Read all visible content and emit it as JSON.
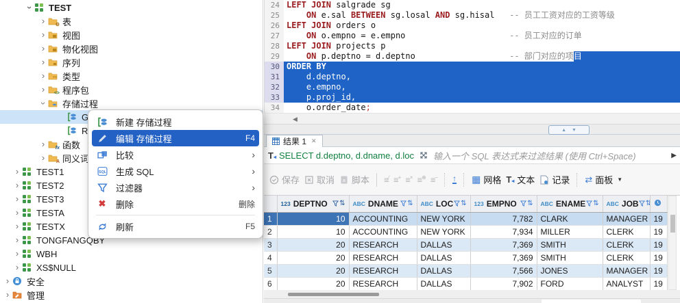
{
  "colors": {
    "accent": "#1e63c5",
    "menu_highlight": "#2461c4",
    "tree_selection": "#cce3f8",
    "keyword": "#9a1b1e",
    "comment": "#8a8a8a",
    "filter_sql_green": "#118040",
    "header_selected": "#7fb0dd",
    "active_cell": "#3d74b6",
    "selected_row": "#c7dcf1"
  },
  "icons": {
    "chevron": "›",
    "close": "✕",
    "submenu_arrow": "›",
    "delete_x": "✖",
    "left_scroll_arrow": "◀",
    "up_triangle": "▲",
    "down_triangle": "▼",
    "grid_glyph": "▦",
    "updown": "⇅",
    "up_arrow": "↑",
    "swap": "⇄",
    "play": "▶",
    "dropdown": "▼",
    "text_T": "T",
    "filter_T": "T",
    "tick": "◂",
    "sql_label": "SQL",
    "script_a": "a",
    "rop_lines": "≡",
    "rop1": "∕",
    "rop2": "+",
    "rop3": "×",
    "rop4": "⊕",
    "rop5": "−",
    "fx": "fx",
    "syn_A": "A",
    "pkg": "<>",
    "gear": "⚙"
  },
  "tree": {
    "items": [
      {
        "label": "TEST"
      },
      {
        "label": "表"
      },
      {
        "label": "视图"
      },
      {
        "label": "物化视图"
      },
      {
        "label": "序列"
      },
      {
        "label": "类型"
      },
      {
        "label": "程序包"
      },
      {
        "label": "存储过程"
      },
      {
        "label": "GET"
      },
      {
        "label": "RAI"
      },
      {
        "label": "函数"
      },
      {
        "label": "同义词"
      },
      {
        "label": "TEST1"
      },
      {
        "label": "TEST2"
      },
      {
        "label": "TEST3"
      },
      {
        "label": "TESTA"
      },
      {
        "label": "TESTX"
      },
      {
        "label": "TONGFANGQBY"
      },
      {
        "label": "WBH"
      },
      {
        "label": "XS$NULL"
      },
      {
        "label": "安全"
      },
      {
        "label": "管理"
      }
    ]
  },
  "menu": {
    "items": [
      {
        "label": "新建 存储过程",
        "accel": ""
      },
      {
        "label": "编辑 存储过程",
        "accel": "F4"
      },
      {
        "label": "比较",
        "accel": ""
      },
      {
        "label": "生成 SQL",
        "accel": ""
      },
      {
        "label": "过滤器",
        "accel": ""
      },
      {
        "label": "删除",
        "accel": "删除"
      },
      {
        "label": "刷新",
        "accel": "F5"
      }
    ]
  },
  "editor": {
    "lines": [
      {
        "no": "24",
        "segs": [
          {
            "c": "kw",
            "t": "LEFT JOIN"
          },
          {
            "c": "pl",
            "t": " salgrade sg"
          }
        ]
      },
      {
        "no": "25",
        "segs": [
          {
            "c": "pl",
            "t": "    "
          },
          {
            "c": "kw",
            "t": "ON"
          },
          {
            "c": "pl",
            "t": " e.sal "
          },
          {
            "c": "kw",
            "t": "BETWEEN"
          },
          {
            "c": "pl",
            "t": " sg.losal "
          },
          {
            "c": "kw",
            "t": "AND"
          },
          {
            "c": "pl",
            "t": " sg.hisal"
          },
          {
            "c": "cm",
            "t": "   -- 员工工资对应的工资等级"
          }
        ]
      },
      {
        "no": "26",
        "segs": [
          {
            "c": "kw",
            "t": "LEFT JOIN"
          },
          {
            "c": "pl",
            "t": " orders o"
          }
        ]
      },
      {
        "no": "27",
        "segs": [
          {
            "c": "pl",
            "t": "    "
          },
          {
            "c": "kw",
            "t": "ON"
          },
          {
            "c": "pl",
            "t": " o.empno = e.empno"
          },
          {
            "c": "cm",
            "t": "                     -- 员工对应的订单"
          }
        ]
      },
      {
        "no": "28",
        "segs": [
          {
            "c": "kw",
            "t": "LEFT JOIN"
          },
          {
            "c": "pl",
            "t": " projects p"
          }
        ]
      },
      {
        "no": "29",
        "segs": [
          {
            "c": "pl",
            "t": "    "
          },
          {
            "c": "kw",
            "t": "ON"
          },
          {
            "c": "pl",
            "t": " p.deptno = d.deptno"
          },
          {
            "c": "cm",
            "t": "                   -- 部门对应的项"
          }
        ],
        "tail": "目"
      },
      {
        "no": "30",
        "segs": [
          {
            "c": "kw",
            "t": "ORDER BY"
          }
        ]
      },
      {
        "no": "31",
        "segs": [
          {
            "c": "pl",
            "t": "    d.deptno,"
          }
        ]
      },
      {
        "no": "32",
        "segs": [
          {
            "c": "pl",
            "t": "    e.empno,"
          }
        ]
      },
      {
        "no": "33",
        "segs": [
          {
            "c": "pl",
            "t": "    p.proj_id,"
          }
        ]
      },
      {
        "no": "34",
        "segs": [
          {
            "c": "pl",
            "t": "    o.order_date"
          },
          {
            "c": "red",
            "t": ";"
          }
        ]
      }
    ]
  },
  "results": {
    "tab_label": "结果 1",
    "filter": {
      "sql": "SELECT d.deptno, d.dname, d.loc",
      "placeholder": "输入一个 SQL 表达式来过滤结果 (使用 Ctrl+Space)"
    },
    "toolbar": {
      "save": "保存",
      "cancel": "取消",
      "script": "脚本",
      "grid": "网格",
      "text": "文本",
      "record": "记录",
      "panels": "面板"
    },
    "grid": {
      "columns": [
        {
          "prefix": "123",
          "name": "DEPTNO"
        },
        {
          "prefix": "ABC",
          "name": "DNAME"
        },
        {
          "prefix": "ABC",
          "name": "LOC"
        },
        {
          "prefix": "123",
          "name": "EMPNO"
        },
        {
          "prefix": "ABC",
          "name": "ENAME"
        },
        {
          "prefix": "ABC",
          "name": "JOB"
        }
      ],
      "rows": [
        {
          "n": "1",
          "deptno": "10",
          "dname": "ACCOUNTING",
          "loc": "NEW YORK",
          "empno": "7,782",
          "ename": "CLARK",
          "job": "MANAGER",
          "extra": "19"
        },
        {
          "n": "2",
          "deptno": "10",
          "dname": "ACCOUNTING",
          "loc": "NEW YORK",
          "empno": "7,934",
          "ename": "MILLER",
          "job": "CLERK",
          "extra": "19"
        },
        {
          "n": "3",
          "deptno": "20",
          "dname": "RESEARCH",
          "loc": "DALLAS",
          "empno": "7,369",
          "ename": "SMITH",
          "job": "CLERK",
          "extra": "19"
        },
        {
          "n": "4",
          "deptno": "20",
          "dname": "RESEARCH",
          "loc": "DALLAS",
          "empno": "7,369",
          "ename": "SMITH",
          "job": "CLERK",
          "extra": "19"
        },
        {
          "n": "5",
          "deptno": "20",
          "dname": "RESEARCH",
          "loc": "DALLAS",
          "empno": "7,566",
          "ename": "JONES",
          "job": "MANAGER",
          "extra": "19"
        },
        {
          "n": "6",
          "deptno": "20",
          "dname": "RESEARCH",
          "loc": "DALLAS",
          "empno": "7,902",
          "ename": "FORD",
          "job": "ANALYST",
          "extra": "19"
        }
      ]
    }
  }
}
